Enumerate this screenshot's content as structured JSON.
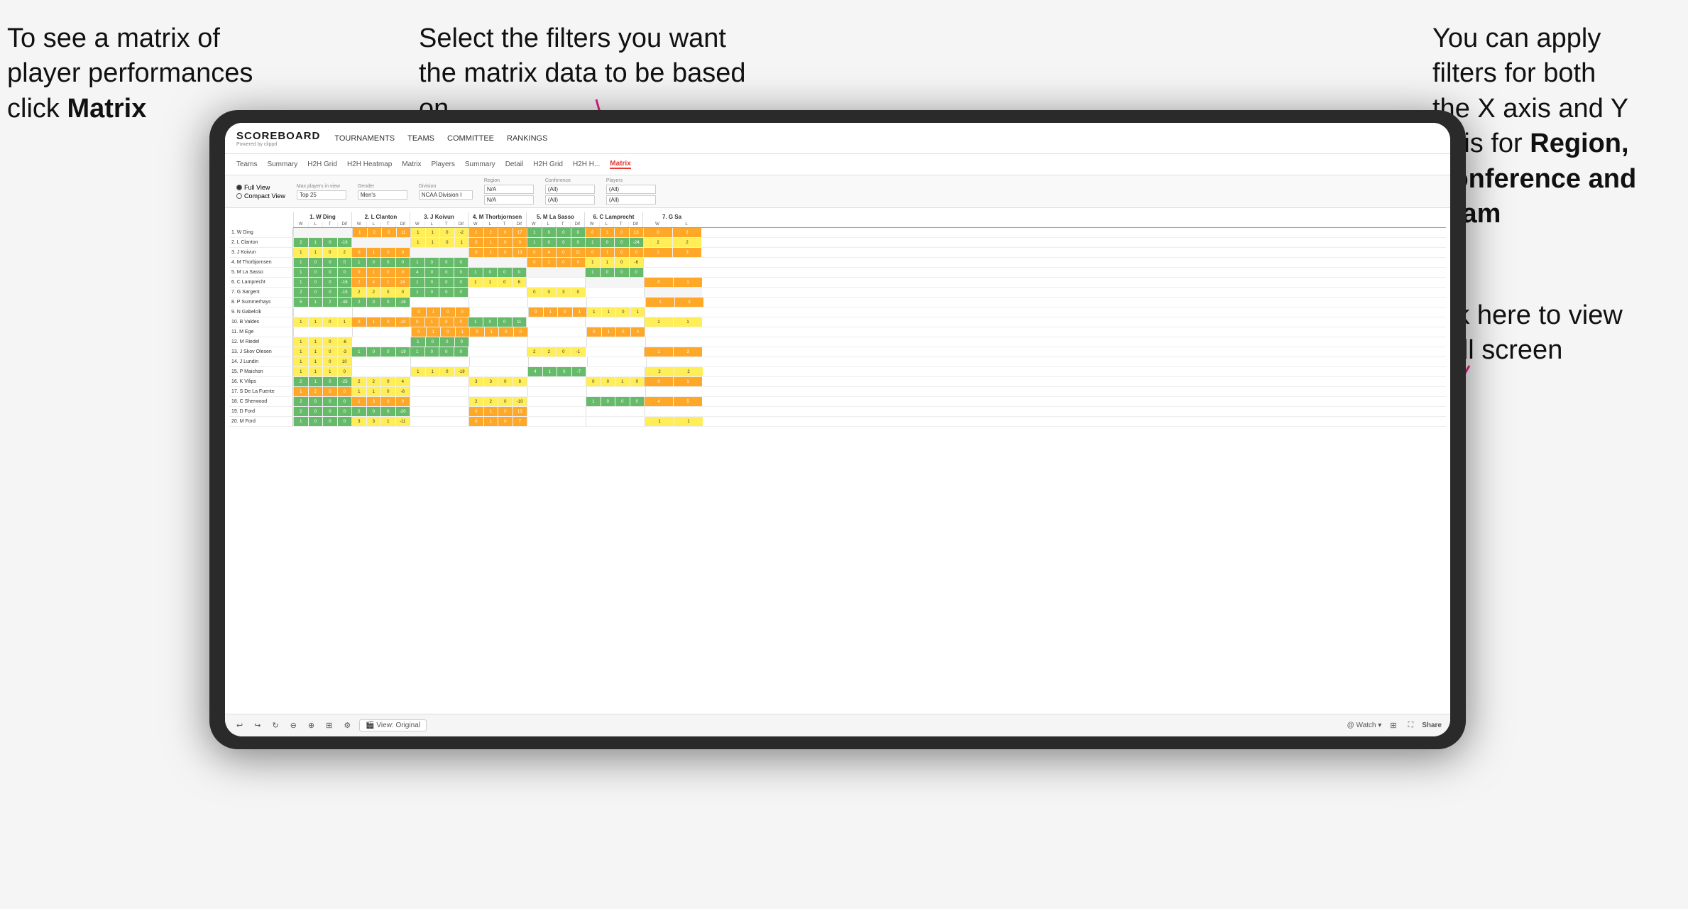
{
  "annotations": {
    "topleft": {
      "line1": "To see a matrix of",
      "line2": "player performances",
      "line3_prefix": "click ",
      "line3_bold": "Matrix"
    },
    "topmid": {
      "text": "Select the filters you want the matrix data to be based on"
    },
    "topright": {
      "line1": "You  can apply",
      "line2": "filters for both",
      "line3": "the X axis and Y",
      "line4_prefix": "Axis for ",
      "line4_bold": "Region,",
      "line5_bold": "Conference and",
      "line6_bold": "Team"
    },
    "bottomright": {
      "line1": "Click here to view",
      "line2": "in full screen"
    }
  },
  "nav": {
    "logo": "SCOREBOARD",
    "logo_sub": "Powered by clippd",
    "items": [
      "TOURNAMENTS",
      "TEAMS",
      "COMMITTEE",
      "RANKINGS"
    ]
  },
  "sub_nav": {
    "items": [
      "Teams",
      "Summary",
      "H2H Grid",
      "H2H Heatmap",
      "Matrix",
      "Players",
      "Summary",
      "Detail",
      "H2H Grid",
      "H2H H...",
      "Matrix"
    ],
    "active_index": 10
  },
  "filters": {
    "view_options": [
      "Full View",
      "Compact View"
    ],
    "selected_view": "Full View",
    "max_players_label": "Max players in view",
    "max_players_value": "Top 25",
    "gender_label": "Gender",
    "gender_value": "Men's",
    "division_label": "Division",
    "division_value": "NCAA Division I",
    "region_label": "Region",
    "region_value": "N/A",
    "conference_label": "Conference",
    "conference_value1": "(All)",
    "conference_value2": "(All)",
    "players_label": "Players",
    "players_value1": "(All)",
    "players_value2": "(All)"
  },
  "col_headers": [
    "1. W Ding",
    "2. L Clanton",
    "3. J Koivun",
    "4. M Thorbjornsen",
    "5. M La Sasso",
    "6. C Lamprecht",
    "7. G Sa"
  ],
  "sub_cols": [
    "W",
    "L",
    "T",
    "Dif"
  ],
  "rows": [
    {
      "label": "1. W Ding",
      "cells": [
        [
          null,
          null,
          null,
          null
        ],
        [
          "1",
          "2",
          "0",
          "11"
        ],
        [
          "1",
          "1",
          "0",
          "-2"
        ],
        [
          "1",
          "2",
          "0",
          "17"
        ],
        [
          "1",
          "0",
          "0",
          "0"
        ],
        [
          "0",
          "1",
          "0",
          "13"
        ],
        [
          "0",
          "2",
          null,
          null
        ]
      ]
    },
    {
      "label": "2. L Clanton",
      "cells": [
        [
          "2",
          "1",
          "0",
          "-16"
        ],
        [
          null,
          null,
          null,
          null
        ],
        [
          "1",
          "1",
          "0",
          "1"
        ],
        [
          "0",
          "1",
          "0",
          "0"
        ],
        [
          "1",
          "0",
          "0",
          "0"
        ],
        [
          "1",
          "0",
          "0",
          "-24"
        ],
        [
          "2",
          "2",
          null,
          null
        ]
      ]
    },
    {
      "label": "3. J Koivun",
      "cells": [
        [
          "1",
          "1",
          "0",
          "2"
        ],
        [
          "0",
          "1",
          "0",
          "0"
        ],
        [
          null,
          null,
          null,
          null
        ],
        [
          "0",
          "1",
          "0",
          "13"
        ],
        [
          "0",
          "4",
          "0",
          "11"
        ],
        [
          "0",
          "1",
          "0",
          "0"
        ],
        [
          "1",
          "3",
          null,
          null
        ]
      ]
    },
    {
      "label": "4. M Thorbjornsen",
      "cells": [
        [
          "1",
          "0",
          "0",
          "0"
        ],
        [
          "1",
          "0",
          "0",
          "0"
        ],
        [
          "1",
          "0",
          "0",
          "0"
        ],
        [
          null,
          null,
          null,
          null
        ],
        [
          "0",
          "1",
          "0",
          "0"
        ],
        [
          "1",
          "1",
          "0",
          "-6"
        ],
        [
          null,
          null,
          null,
          null
        ]
      ]
    },
    {
      "label": "5. M La Sasso",
      "cells": [
        [
          "1",
          "0",
          "0",
          "0"
        ],
        [
          "0",
          "1",
          "0",
          "0"
        ],
        [
          "4",
          "0",
          "0",
          "0"
        ],
        [
          "1",
          "0",
          "0",
          "0"
        ],
        [
          null,
          null,
          null,
          null
        ],
        [
          "1",
          "0",
          "0",
          "0"
        ],
        [
          null,
          null,
          null,
          null
        ]
      ]
    },
    {
      "label": "6. C Lamprecht",
      "cells": [
        [
          "1",
          "0",
          "0",
          "-16"
        ],
        [
          "2",
          "4",
          "1",
          "24"
        ],
        [
          "1",
          "0",
          "0",
          "0"
        ],
        [
          "1",
          "1",
          "0",
          "6"
        ],
        [
          null,
          null,
          null,
          null
        ],
        [
          null,
          null,
          null,
          null
        ],
        [
          "0",
          "1",
          null,
          null
        ]
      ]
    },
    {
      "label": "7. G Sargent",
      "cells": [
        [
          "2",
          "0",
          "0",
          "-15"
        ],
        [
          "2",
          "2",
          "0",
          "0"
        ],
        [
          "1",
          "0",
          "0",
          "0"
        ],
        [
          null,
          null,
          null,
          null
        ],
        [
          "0",
          "0",
          "3",
          "0"
        ],
        [
          null,
          null,
          null,
          null
        ],
        [
          null,
          null,
          null,
          null
        ]
      ]
    },
    {
      "label": "8. P Summerhays",
      "cells": [
        [
          "5",
          "1",
          "2",
          "-48"
        ],
        [
          "2",
          "0",
          "0",
          "-16"
        ],
        [
          null,
          null,
          null,
          null
        ],
        [
          null,
          null,
          null,
          null
        ],
        [
          null,
          null,
          null,
          null
        ],
        [
          null,
          null,
          null,
          null
        ],
        [
          "1",
          "2",
          null,
          null
        ]
      ]
    },
    {
      "label": "9. N Gabelcik",
      "cells": [
        [
          null,
          null,
          null,
          null
        ],
        [
          null,
          null,
          null,
          null
        ],
        [
          "0",
          "1",
          "0",
          "0"
        ],
        [
          null,
          null,
          null,
          null
        ],
        [
          "0",
          "1",
          "0",
          "1"
        ],
        [
          "1",
          "1",
          "0",
          "1"
        ],
        [
          null,
          null,
          null,
          null
        ]
      ]
    },
    {
      "label": "10. B Valdes",
      "cells": [
        [
          "1",
          "1",
          "0",
          "1"
        ],
        [
          "0",
          "1",
          "0",
          "-10"
        ],
        [
          "0",
          "1",
          "0",
          "0"
        ],
        [
          "1",
          "0",
          "0",
          "11"
        ],
        [
          null,
          null,
          null,
          null
        ],
        [
          null,
          null,
          null,
          null
        ],
        [
          "1",
          "1",
          null,
          null
        ]
      ]
    },
    {
      "label": "11. M Ege",
      "cells": [
        [
          null,
          null,
          null,
          null
        ],
        [
          null,
          null,
          null,
          null
        ],
        [
          "0",
          "1",
          "0",
          "1"
        ],
        [
          "0",
          "1",
          "0",
          "0"
        ],
        [
          null,
          null,
          null,
          null
        ],
        [
          "0",
          "1",
          "0",
          "4"
        ],
        [
          null,
          null,
          null,
          null
        ]
      ]
    },
    {
      "label": "12. M Riedel",
      "cells": [
        [
          "1",
          "1",
          "0",
          "-6"
        ],
        [
          null,
          null,
          null,
          null
        ],
        [
          "1",
          "0",
          "0",
          "0"
        ],
        [
          null,
          null,
          null,
          null
        ],
        [
          null,
          null,
          null,
          null
        ],
        [
          null,
          null,
          null,
          null
        ],
        [
          null,
          null,
          null,
          null
        ]
      ]
    },
    {
      "label": "13. J Skov Olesen",
      "cells": [
        [
          "1",
          "1",
          "0",
          "-3"
        ],
        [
          "1",
          "0",
          "0",
          "-19"
        ],
        [
          "1",
          "0",
          "0",
          "0"
        ],
        [
          null,
          null,
          null,
          null
        ],
        [
          "2",
          "2",
          "0",
          "-1"
        ],
        [
          null,
          null,
          null,
          null
        ],
        [
          "1",
          "3",
          null,
          null
        ]
      ]
    },
    {
      "label": "14. J Lundin",
      "cells": [
        [
          "1",
          "1",
          "0",
          "10"
        ],
        [
          null,
          null,
          null,
          null
        ],
        [
          null,
          null,
          null,
          null
        ],
        [
          null,
          null,
          null,
          null
        ],
        [
          null,
          null,
          null,
          null
        ],
        [
          null,
          null,
          null,
          null
        ],
        [
          null,
          null,
          null,
          null
        ]
      ]
    },
    {
      "label": "15. P Maichon",
      "cells": [
        [
          "1",
          "1",
          "1",
          "0"
        ],
        [
          null,
          null,
          null,
          null
        ],
        [
          "1",
          "1",
          "0",
          "-19"
        ],
        [
          null,
          null,
          null,
          null
        ],
        [
          "4",
          "1",
          "0",
          "-7"
        ],
        [
          null,
          null,
          null,
          null
        ],
        [
          "2",
          "2",
          null,
          null
        ]
      ]
    },
    {
      "label": "16. K Vilips",
      "cells": [
        [
          "2",
          "1",
          "0",
          "-25"
        ],
        [
          "2",
          "2",
          "0",
          "4"
        ],
        [
          null,
          null,
          null,
          null
        ],
        [
          "3",
          "3",
          "0",
          "8"
        ],
        [
          null,
          null,
          null,
          null
        ],
        [
          "0",
          "0",
          "1",
          "0"
        ],
        [
          "0",
          "1",
          null,
          null
        ]
      ]
    },
    {
      "label": "17. S De La Fuente",
      "cells": [
        [
          "1",
          "2",
          "0",
          "0"
        ],
        [
          "1",
          "1",
          "0",
          "-8"
        ],
        [
          null,
          null,
          null,
          null
        ],
        [
          null,
          null,
          null,
          null
        ],
        [
          null,
          null,
          null,
          null
        ],
        [
          null,
          null,
          null,
          null
        ],
        [
          null,
          null,
          null,
          null
        ]
      ]
    },
    {
      "label": "18. C Sherwood",
      "cells": [
        [
          "2",
          "0",
          "0",
          "0"
        ],
        [
          "1",
          "3",
          "0",
          "0"
        ],
        [
          null,
          null,
          null,
          null
        ],
        [
          "2",
          "2",
          "0",
          "-10"
        ],
        [
          null,
          null,
          null,
          null
        ],
        [
          "1",
          "0",
          "0",
          "0"
        ],
        [
          "4",
          "5",
          null,
          null
        ]
      ]
    },
    {
      "label": "19. D Ford",
      "cells": [
        [
          "2",
          "0",
          "0",
          "0"
        ],
        [
          "2",
          "0",
          "0",
          "-20"
        ],
        [
          null,
          null,
          null,
          null
        ],
        [
          "0",
          "1",
          "0",
          "13"
        ],
        [
          null,
          null,
          null,
          null
        ],
        [
          null,
          null,
          null,
          null
        ],
        [
          null,
          null,
          null,
          null
        ]
      ]
    },
    {
      "label": "20. M Ford",
      "cells": [
        [
          "1",
          "0",
          "0",
          "0"
        ],
        [
          "3",
          "3",
          "1",
          "-11"
        ],
        [
          null,
          null,
          null,
          null
        ],
        [
          "0",
          "1",
          "0",
          "7"
        ],
        [
          null,
          null,
          null,
          null
        ],
        [
          null,
          null,
          null,
          null
        ],
        [
          "1",
          "1",
          null,
          null
        ]
      ]
    }
  ],
  "toolbar": {
    "view_original": "🎬 View: Original",
    "watch": "@ Watch ▾",
    "share": "Share"
  }
}
